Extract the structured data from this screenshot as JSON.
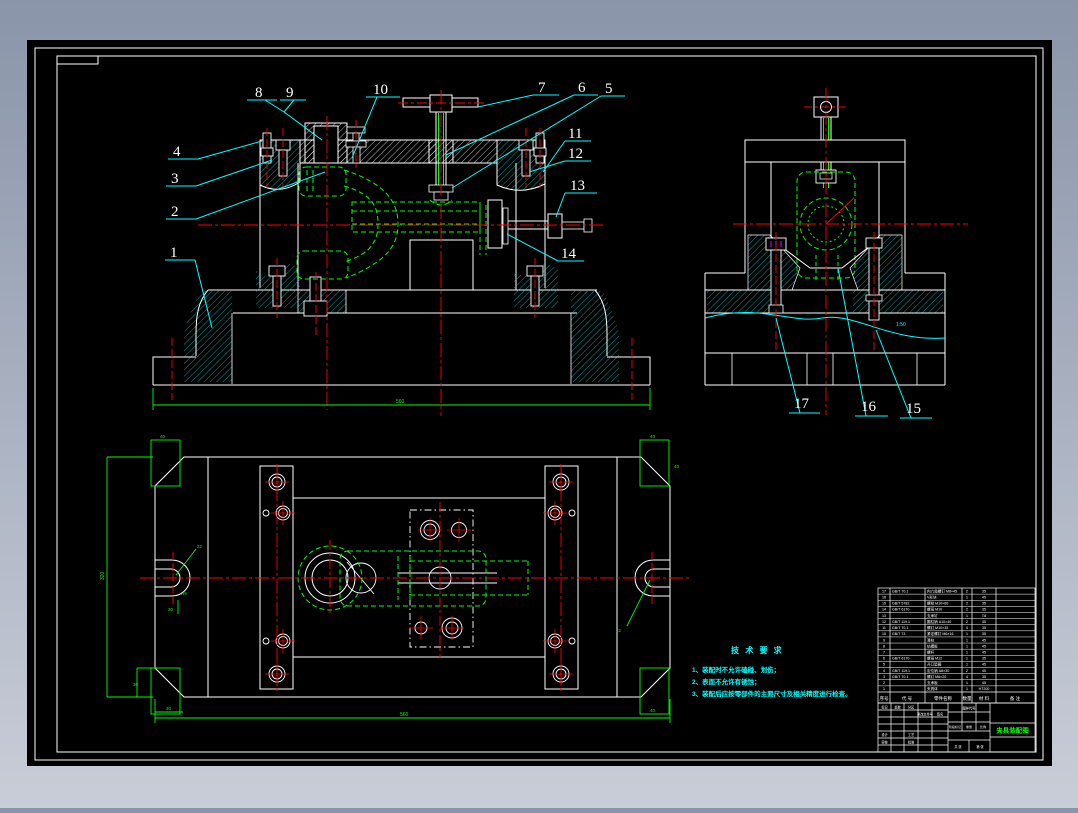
{
  "colors": {
    "background_top": "#8a95a9",
    "background_bottom": "#c9cdd8",
    "canvas": "#000000",
    "line": "#ffffff",
    "leader": "#00ffff",
    "dimension": "#00ff00",
    "centerline": "#ff0000",
    "thread_mark": "#ff00ff",
    "title_highlight": "#00ff00"
  },
  "callouts": [
    "1",
    "2",
    "3",
    "4",
    "5",
    "6",
    "7",
    "8",
    "9",
    "10",
    "11",
    "12",
    "13",
    "14",
    "15",
    "16",
    "17"
  ],
  "tech_requirements": {
    "title": "技 术 要 求",
    "lines": [
      "1、装配时不允许磕碰、划伤；",
      "2、表面不允许有锈蚀；",
      "3、装配后应按零部件的主要尺寸及相关精度进行检查。"
    ]
  },
  "dimensions": {
    "front_width": "560",
    "plan_width": "560",
    "plan_height": "320",
    "corner": "40",
    "foot": "30",
    "slot_width": "22",
    "slot_radius": "R9",
    "taper": "1:50"
  },
  "title_block": {
    "drawing_title": "夹具装配图",
    "bom_headers": {
      "seq": "序号",
      "code": "代  号",
      "name": "零件名称",
      "qty": "数量",
      "material": "材 料",
      "remark": "备 注"
    },
    "fields": {
      "mark": "标记",
      "count": "处数",
      "zone": "分区",
      "doc_no": "更改文件号",
      "sign": "签名",
      "design": "设计",
      "check": "审核",
      "process": "工艺",
      "approve": "批准",
      "code_cell": "图样代号",
      "stage": "阶段标记",
      "weight": "重量",
      "scale": "比例",
      "sheet": "共  张",
      "page": "第  张"
    },
    "bom": {
      "rows": [
        {
          "num": "1",
          "code": "",
          "name": "夹具体",
          "qty": "1",
          "material": "HT200",
          "remark": ""
        },
        {
          "num": "2",
          "code": "",
          "name": "支承板",
          "qty": "1",
          "material": "45",
          "remark": ""
        },
        {
          "num": "3",
          "code": "GB/T 70.1",
          "name": "螺钉 M8×20",
          "qty": "4",
          "material": "35",
          "remark": ""
        },
        {
          "num": "4",
          "code": "GB/T 119.1",
          "name": "定位销 A8×30",
          "qty": "2",
          "material": "45",
          "remark": ""
        },
        {
          "num": "5",
          "code": "",
          "name": "开口垫圈",
          "qty": "1",
          "material": "45",
          "remark": ""
        },
        {
          "num": "6",
          "code": "GB/T 6170",
          "name": "螺母 M12",
          "qty": "1",
          "material": "35",
          "remark": ""
        },
        {
          "num": "7",
          "code": "",
          "name": "螺杆",
          "qty": "1",
          "material": "45",
          "remark": ""
        },
        {
          "num": "8",
          "code": "",
          "name": "钻模板",
          "qty": "1",
          "material": "45",
          "remark": ""
        },
        {
          "num": "9",
          "code": "",
          "name": "滑柱",
          "qty": "1",
          "material": "45",
          "remark": ""
        },
        {
          "num": "10",
          "code": "GB/T 73",
          "name": "紧定螺钉 M6×16",
          "qty": "1",
          "material": "35",
          "remark": ""
        },
        {
          "num": "11",
          "code": "GB/T 70.1",
          "name": "螺钉 M10×35",
          "qty": "4",
          "material": "35",
          "remark": ""
        },
        {
          "num": "12",
          "code": "GB/T 119.1",
          "name": "圆柱销 A10×40",
          "qty": "2",
          "material": "45",
          "remark": ""
        },
        {
          "num": "13",
          "code": "",
          "name": "支承钉",
          "qty": "1",
          "material": "T8",
          "remark": ""
        },
        {
          "num": "14",
          "code": "GB/T 6170",
          "name": "螺母 M10",
          "qty": "2",
          "material": "35",
          "remark": ""
        },
        {
          "num": "15",
          "code": "GB/T 5782",
          "name": "螺栓 M10×60",
          "qty": "2",
          "material": "35",
          "remark": ""
        },
        {
          "num": "16",
          "code": "",
          "name": "V形块",
          "qty": "1",
          "material": "45",
          "remark": ""
        },
        {
          "num": "17",
          "code": "GB/T 70.1",
          "name": "内六角螺钉 M8×45",
          "qty": "2",
          "material": "35",
          "remark": ""
        }
      ]
    }
  }
}
